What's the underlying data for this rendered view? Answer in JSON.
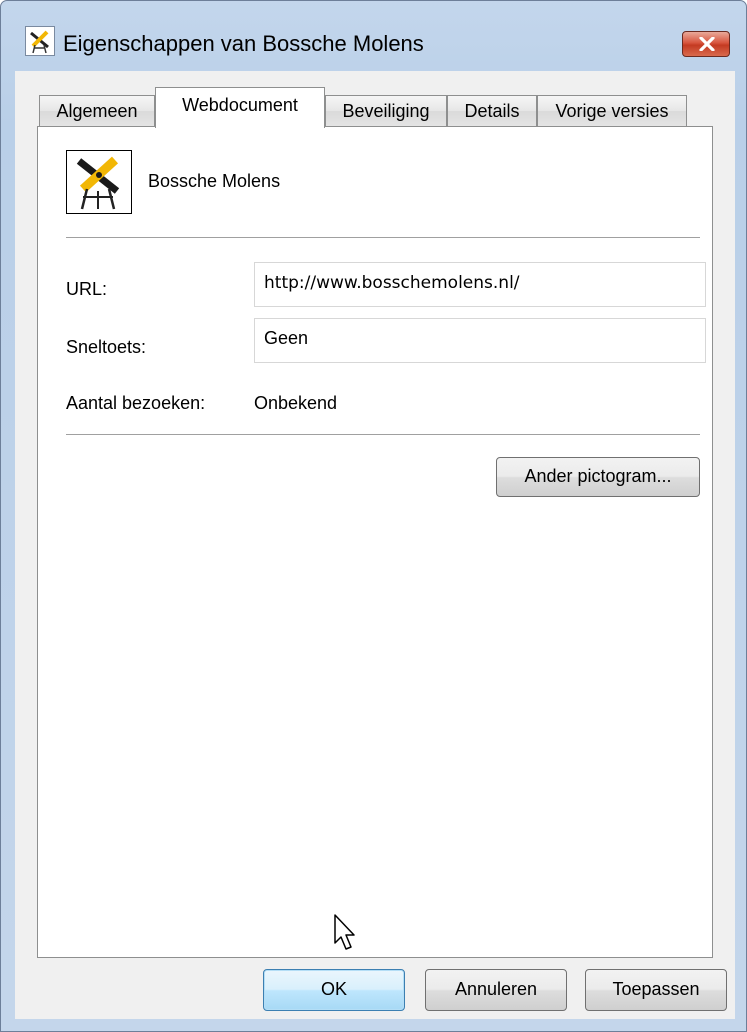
{
  "window": {
    "title": "Eigenschappen van Bossche Molens",
    "icon": "windmill-icon",
    "close_icon": "close-icon",
    "accent_close": "#c43a22"
  },
  "tabs": [
    {
      "label": "Algemeen",
      "active": false
    },
    {
      "label": "Webdocument",
      "active": true
    },
    {
      "label": "Beveiliging",
      "active": false
    },
    {
      "label": "Details",
      "active": false
    },
    {
      "label": "Vorige versies",
      "active": false
    }
  ],
  "panel": {
    "site_name": "Bossche Molens",
    "site_icon": "windmill-icon",
    "url_label": "URL:",
    "url_value": "http://www.bosschemolens.nl/",
    "shortcut_label": "Sneltoets:",
    "shortcut_value": "Geen",
    "visits_label": "Aantal bezoeken:",
    "visits_value": "Onbekend",
    "change_icon_button": "Ander pictogram..."
  },
  "footer": {
    "ok": "OK",
    "cancel": "Annuleren",
    "apply": "Toepassen"
  }
}
